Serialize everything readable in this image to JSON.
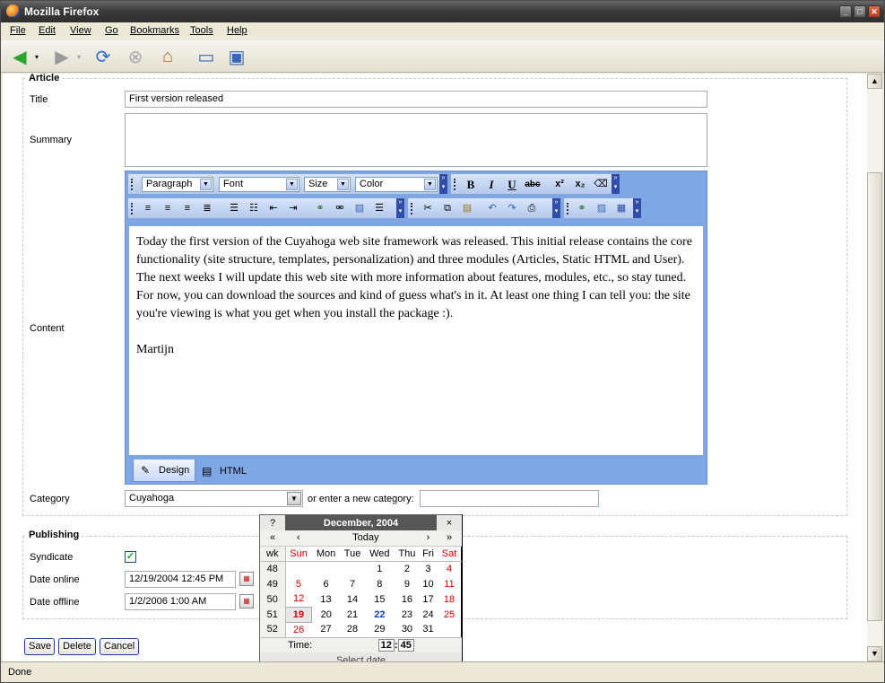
{
  "window": {
    "title": "Mozilla Firefox"
  },
  "menu": [
    "File",
    "Edit",
    "View",
    "Go",
    "Bookmarks",
    "Tools",
    "Help"
  ],
  "toolbar": {
    "go_label": "Go",
    "url": "",
    "search_engine_icon": "google-icon"
  },
  "article": {
    "legend": "Article",
    "title_label": "Title",
    "title_value": "First version released",
    "summary_label": "Summary",
    "summary_value": "",
    "content_label": "Content",
    "editor": {
      "paragraph": "Paragraph",
      "font": "Font",
      "size": "Size",
      "color": "Color",
      "bold": "B",
      "italic": "I",
      "underline": "U",
      "strike": "abc",
      "superscript": "x²",
      "subscript": "x₂"
    },
    "content_paragraphs": [
      "Today the first version of the Cuyahoga web site framework was released. This initial release contains the core functionality (site structure, templates, personalization) and three modules (Articles, Static HTML and User).",
      "The next weeks I will update this web site with more information about features, modules, etc., so stay tuned. For now, you can download the sources and kind of guess what's in it. At least one thing I can tell you: the site you're viewing is what you get when you install the package :).",
      "",
      "Martijn"
    ],
    "tabs": {
      "design": "Design",
      "html": "HTML"
    },
    "category_label": "Category",
    "category_value": "Cuyahoga",
    "new_category_label": "or enter a new category:",
    "new_category_value": ""
  },
  "publishing": {
    "legend": "Publishing",
    "syndicate_label": "Syndicate",
    "syndicate_checked": true,
    "date_online_label": "Date online",
    "date_online_value": "12/19/2004 12:45 PM",
    "date_offline_label": "Date offline",
    "date_offline_value": "1/2/2006 1:00 AM"
  },
  "buttons": {
    "save": "Save",
    "delete": "Delete",
    "cancel": "Cancel"
  },
  "calendar": {
    "help": "?",
    "title": "December, 2004",
    "close": "×",
    "prev_year": "«",
    "prev_month": "‹",
    "today_label": "Today",
    "next_month": "›",
    "next_year": "»",
    "wk_header": "wk",
    "day_headers": [
      "Sun",
      "Mon",
      "Tue",
      "Wed",
      "Thu",
      "Fri",
      "Sat"
    ],
    "weeks": [
      {
        "wk": "48",
        "days": [
          "",
          "",
          "",
          "1",
          "2",
          "3",
          "4"
        ]
      },
      {
        "wk": "49",
        "days": [
          "5",
          "6",
          "7",
          "8",
          "9",
          "10",
          "11"
        ]
      },
      {
        "wk": "50",
        "days": [
          "12",
          "13",
          "14",
          "15",
          "16",
          "17",
          "18"
        ]
      },
      {
        "wk": "51",
        "days": [
          "19",
          "20",
          "21",
          "22",
          "23",
          "24",
          "25"
        ]
      },
      {
        "wk": "52",
        "days": [
          "26",
          "27",
          "28",
          "29",
          "30",
          "31",
          ""
        ]
      }
    ],
    "selected_day": "19",
    "today_day": "22",
    "time_label": "Time:",
    "hour": "12",
    "minute": "45",
    "footer": "Select date"
  },
  "status": {
    "text": "Done"
  }
}
